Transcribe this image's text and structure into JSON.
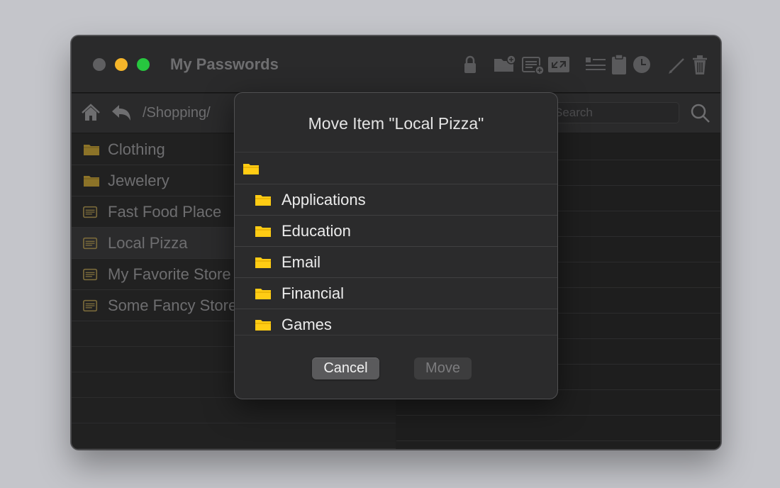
{
  "window": {
    "title": "My Passwords"
  },
  "toolbar": {
    "icons": [
      "lock-icon",
      "new-folder-icon",
      "new-item-icon",
      "import-icon",
      "list-icon",
      "clipboard-icon",
      "clock-icon",
      "edit-icon",
      "trash-icon"
    ]
  },
  "nav": {
    "path": "/Shopping/",
    "search_placeholder": "Search"
  },
  "list": {
    "items": [
      {
        "label": "Clothing",
        "type": "folder"
      },
      {
        "label": "Jewelery",
        "type": "folder"
      },
      {
        "label": "Fast Food Place",
        "type": "entry"
      },
      {
        "label": "Local Pizza",
        "type": "entry",
        "selected": true
      },
      {
        "label": "My Favorite Store",
        "type": "entry"
      },
      {
        "label": "Some Fancy Store",
        "type": "entry"
      }
    ]
  },
  "dialog": {
    "title": "Move Item \"Local Pizza\"",
    "folders": [
      "Applications",
      "Education",
      "Email",
      "Financial",
      "Games"
    ],
    "cancel_label": "Cancel",
    "move_label": "Move"
  },
  "colors": {
    "folder_yellow": "#ffcc14",
    "traffic_red": "#5f5f61",
    "traffic_yellow": "#f5b52a",
    "traffic_green": "#27c73f"
  }
}
